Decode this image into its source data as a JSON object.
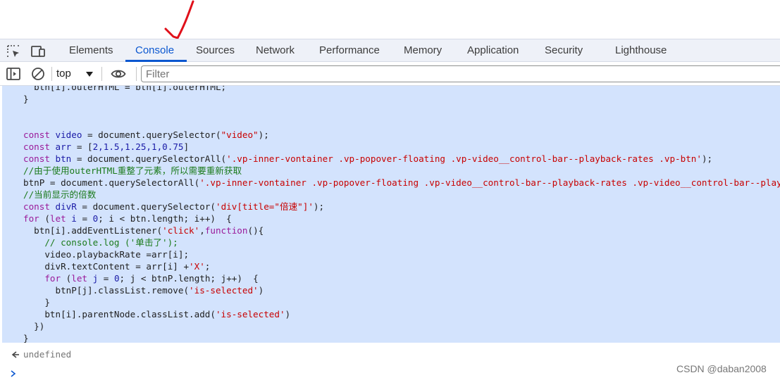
{
  "tabs": [
    {
      "label": "Elements"
    },
    {
      "label": "Console"
    },
    {
      "label": "Sources"
    },
    {
      "label": "Network"
    },
    {
      "label": "Performance"
    },
    {
      "label": "Memory"
    },
    {
      "label": "Application"
    },
    {
      "label": "Security"
    },
    {
      "label": "Lighthouse"
    }
  ],
  "active_tab": "Console",
  "toolbar": {
    "context_label": "top",
    "filter_placeholder": "Filter"
  },
  "code": {
    "lines": [
      [
        {
          "t": "  btn[i].outerHTML = btn[i].outerHTML;",
          "c": "tx"
        }
      ],
      [
        {
          "t": "}",
          "c": "tx"
        }
      ],
      [],
      [],
      [
        {
          "t": "const ",
          "c": "kw"
        },
        {
          "t": "video",
          "c": "vn"
        },
        {
          "t": " = document.querySelector(",
          "c": "tx"
        },
        {
          "t": "\"video\"",
          "c": "str"
        },
        {
          "t": ");",
          "c": "tx"
        }
      ],
      [
        {
          "t": "const ",
          "c": "kw"
        },
        {
          "t": "arr",
          "c": "vn"
        },
        {
          "t": " = [",
          "c": "tx"
        },
        {
          "t": "2,1.5,1.25,1,0.75",
          "c": "num"
        },
        {
          "t": "]",
          "c": "tx"
        }
      ],
      [
        {
          "t": "const ",
          "c": "kw"
        },
        {
          "t": "btn",
          "c": "vn"
        },
        {
          "t": " = document.querySelectorAll(",
          "c": "tx"
        },
        {
          "t": "'.vp-inner-vontainer .vp-popover-floating .vp-video__control-bar--playback-rates .vp-btn'",
          "c": "str"
        },
        {
          "t": ");",
          "c": "tx"
        }
      ],
      [
        {
          "t": "//由于使用outerHTML重整了元素，所以需要重新获取",
          "c": "cm"
        }
      ],
      [
        {
          "t": "btnP = document.querySelectorAll(",
          "c": "tx"
        },
        {
          "t": "'.vp-inner-vontainer .vp-popover-floating .vp-video__control-bar--playback-rates .vp-video__control-bar--playback-rates-item'",
          "c": "str"
        },
        {
          "t": ");",
          "c": "tx"
        }
      ],
      [
        {
          "t": "//当前显示的倍数",
          "c": "cm"
        }
      ],
      [
        {
          "t": "const ",
          "c": "kw"
        },
        {
          "t": "divR",
          "c": "vn"
        },
        {
          "t": " = document.querySelector(",
          "c": "tx"
        },
        {
          "t": "'div[title=\"倍速\"]'",
          "c": "str"
        },
        {
          "t": ");",
          "c": "tx"
        }
      ],
      [
        {
          "t": "for",
          "c": "kw"
        },
        {
          "t": " (",
          "c": "tx"
        },
        {
          "t": "let ",
          "c": "kw"
        },
        {
          "t": "i",
          "c": "vn"
        },
        {
          "t": " = ",
          "c": "tx"
        },
        {
          "t": "0",
          "c": "num"
        },
        {
          "t": "; i < btn.length; i++)  {",
          "c": "tx"
        }
      ],
      [
        {
          "t": "  btn[i].addEventListener(",
          "c": "tx"
        },
        {
          "t": "'click'",
          "c": "str"
        },
        {
          "t": ",",
          "c": "tx"
        },
        {
          "t": "function",
          "c": "kw"
        },
        {
          "t": "(){",
          "c": "tx"
        }
      ],
      [
        {
          "t": "    // console.log ('单击了');",
          "c": "cm"
        }
      ],
      [
        {
          "t": "    video.playbackRate =arr[i];",
          "c": "tx"
        }
      ],
      [
        {
          "t": "    divR.textContent = arr[i] +",
          "c": "tx"
        },
        {
          "t": "'X'",
          "c": "str"
        },
        {
          "t": ";",
          "c": "tx"
        }
      ],
      [
        {
          "t": "    ",
          "c": "tx"
        },
        {
          "t": "for",
          "c": "kw"
        },
        {
          "t": " (",
          "c": "tx"
        },
        {
          "t": "let ",
          "c": "kw"
        },
        {
          "t": "j",
          "c": "vn"
        },
        {
          "t": " = ",
          "c": "tx"
        },
        {
          "t": "0",
          "c": "num"
        },
        {
          "t": "; j < btnP.length; j++)  {",
          "c": "tx"
        }
      ],
      [
        {
          "t": "      btnP[j].classList.remove(",
          "c": "tx"
        },
        {
          "t": "'is-selected'",
          "c": "str"
        },
        {
          "t": ")",
          "c": "tx"
        }
      ],
      [
        {
          "t": "    }",
          "c": "tx"
        }
      ],
      [
        {
          "t": "    btn[i].parentNode.classList.add(",
          "c": "tx"
        },
        {
          "t": "'is-selected'",
          "c": "str"
        },
        {
          "t": ")",
          "c": "tx"
        }
      ],
      [
        {
          "t": "  })",
          "c": "tx"
        }
      ],
      [
        {
          "t": "}",
          "c": "tx"
        }
      ]
    ]
  },
  "result": {
    "text": "undefined"
  },
  "watermark": "CSDN @daban2008",
  "colors": {
    "accent": "#0b57d0",
    "selection_bg": "#d3e3fd",
    "annotation_red": "#e0101a"
  },
  "icons": {
    "annotation": "red-check-arrow",
    "inspect": "inspect-element-icon",
    "device": "device-toolbar-icon",
    "sidebar": "sidebar-toggle-icon",
    "clear": "clear-console-icon",
    "live_expression": "eye-icon"
  }
}
